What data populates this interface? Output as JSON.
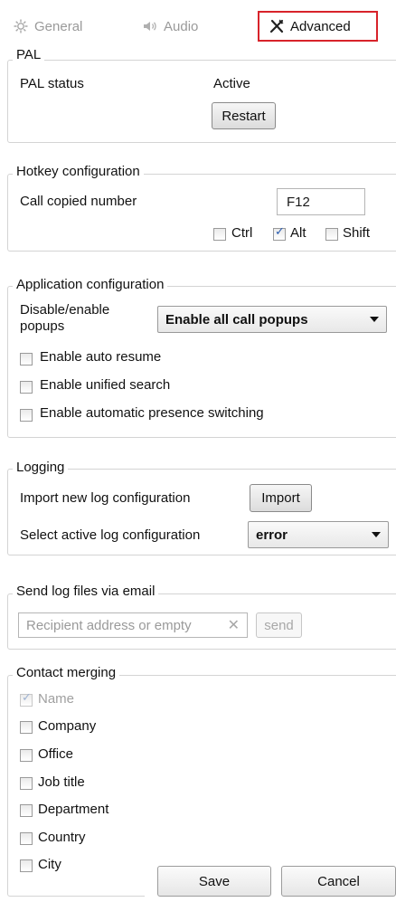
{
  "tabs": [
    {
      "label": "General",
      "icon": "gear-icon",
      "active": false
    },
    {
      "label": "Audio",
      "icon": "speaker-icon",
      "active": false
    },
    {
      "label": "Advanced",
      "icon": "tools-icon",
      "active": true
    }
  ],
  "pal": {
    "title": "PAL",
    "status_label": "PAL status",
    "status_value": "Active",
    "restart_label": "Restart"
  },
  "hotkey": {
    "title": "Hotkey configuration",
    "call_label": "Call copied number",
    "key_value": "F12",
    "modifiers": [
      {
        "label": "Ctrl",
        "checked": false
      },
      {
        "label": "Alt",
        "checked": true
      },
      {
        "label": "Shift",
        "checked": false
      }
    ]
  },
  "app": {
    "title": "Application configuration",
    "popups_label": "Disable/enable popups",
    "popups_label_line1": "Disable/enable",
    "popups_label_line2": "popups",
    "popups_value": "Enable all call popups",
    "options": [
      {
        "label": "Enable auto resume",
        "checked": false
      },
      {
        "label": "Enable unified search",
        "checked": false
      },
      {
        "label": "Enable automatic presence switching",
        "checked": false
      }
    ]
  },
  "logging": {
    "title": "Logging",
    "import_label": "Import new log configuration",
    "import_button": "Import",
    "select_label": "Select active log configuration",
    "select_value": "error"
  },
  "email": {
    "title": "Send log files via email",
    "placeholder": "Recipient address or empty",
    "send_label": "send"
  },
  "merging": {
    "title": "Contact merging",
    "items": [
      {
        "label": "Name",
        "checked": true,
        "disabled": true
      },
      {
        "label": "Company",
        "checked": false,
        "disabled": false
      },
      {
        "label": "Office",
        "checked": false,
        "disabled": false
      },
      {
        "label": "Job title",
        "checked": false,
        "disabled": false
      },
      {
        "label": "Department",
        "checked": false,
        "disabled": false
      },
      {
        "label": "Country",
        "checked": false,
        "disabled": false
      },
      {
        "label": "City",
        "checked": false,
        "disabled": false
      }
    ]
  },
  "footer": {
    "save_label": "Save",
    "cancel_label": "Cancel"
  },
  "colors": {
    "active_tab_border": "#d8232a",
    "check_color": "#2a5db0"
  }
}
